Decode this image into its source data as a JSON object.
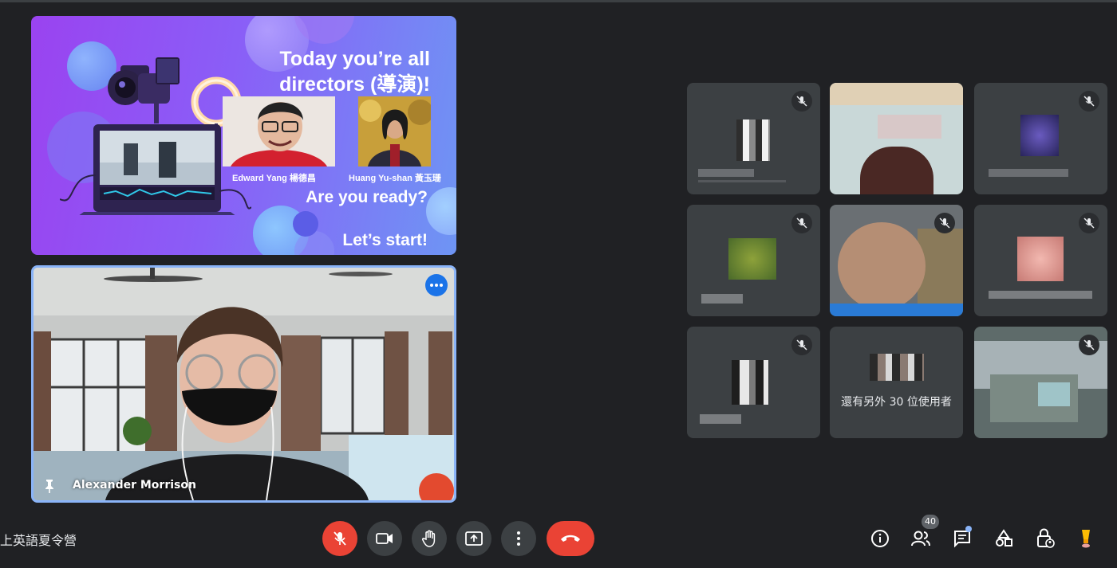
{
  "slide": {
    "title_line1": "Today you’re all",
    "title_line2": "directors (導演)!",
    "caption_left": "Edward Yang 楊德昌",
    "caption_right": "Huang Yu-shan 黃玉珊",
    "question": "Are you ready?",
    "start": "Let’s start!"
  },
  "pinned": {
    "name": "Alexander Morrison"
  },
  "grid": {
    "more_others": "還有另外 30 位使用者",
    "tiles": [
      {
        "muted": true
      },
      {
        "muted": false
      },
      {
        "muted": true
      },
      {
        "muted": true
      },
      {
        "muted": true
      },
      {
        "muted": true
      },
      {
        "muted": true
      },
      {
        "muted": false
      },
      {
        "muted": true
      }
    ]
  },
  "meeting": {
    "title": "上英語夏令營"
  },
  "toolbar": {
    "participants_count": "40"
  },
  "colors": {
    "background": "#202124",
    "tile": "#3c4043",
    "danger": "#ea4335",
    "accent": "#8ab4f8",
    "primary": "#1a73e8"
  }
}
